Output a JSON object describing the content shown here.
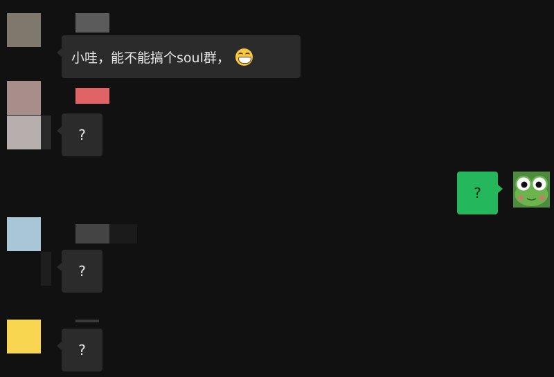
{
  "chat": {
    "messages": [
      {
        "sender": "contact",
        "text": "小哇，能不能搞个soul群，",
        "emoji": "grinning-squinting-face-icon"
      },
      {
        "sender": "contact",
        "text": "?"
      },
      {
        "sender": "self",
        "text": "?",
        "avatar": "green-frog-avatar-icon"
      },
      {
        "sender": "contact",
        "text": "?"
      },
      {
        "sender": "contact",
        "text": "?"
      }
    ]
  },
  "colors": {
    "background": "#111111",
    "incoming_bubble": "#2b2b2b",
    "outgoing_bubble": "#24b75c"
  }
}
